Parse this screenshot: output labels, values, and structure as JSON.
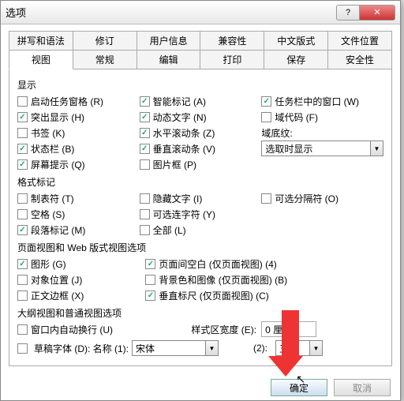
{
  "window": {
    "title": "选项"
  },
  "tabs_row1": [
    "拼写和语法",
    "修订",
    "用户信息",
    "兼容性",
    "中文版式",
    "文件位置"
  ],
  "tabs_row2": [
    "视图",
    "常规",
    "编辑",
    "打印",
    "保存",
    "安全性"
  ],
  "active_tab": "视图",
  "sections": {
    "display": {
      "title": "显示",
      "col1": [
        {
          "label": "启动任务窗格 (R)",
          "checked": false
        },
        {
          "label": "突出显示 (H)",
          "checked": true
        },
        {
          "label": "书签 (K)",
          "checked": false
        },
        {
          "label": "状态栏 (B)",
          "checked": true
        },
        {
          "label": "屏幕提示 (Q)",
          "checked": true
        }
      ],
      "col2": [
        {
          "label": "智能标记 (A)",
          "checked": true
        },
        {
          "label": "动态文字 (N)",
          "checked": true
        },
        {
          "label": "水平滚动条 (Z)",
          "checked": true
        },
        {
          "label": "垂直滚动条 (V)",
          "checked": true
        },
        {
          "label": "图片框 (P)",
          "checked": false
        }
      ],
      "col3": [
        {
          "label": "任务栏中的窗口 (W)",
          "checked": true
        },
        {
          "label": "域代码 (F)",
          "checked": false
        }
      ],
      "shading_label": "域底纹:",
      "shading_value": "选取时显示"
    },
    "marks": {
      "title": "格式标记",
      "col1": [
        {
          "label": "制表符 (T)",
          "checked": false
        },
        {
          "label": "空格 (S)",
          "checked": false
        },
        {
          "label": "段落标记 (M)",
          "checked": true
        }
      ],
      "col2": [
        {
          "label": "隐藏文字 (I)",
          "checked": false
        },
        {
          "label": "可选连字符 (Y)",
          "checked": false
        },
        {
          "label": "全部 (L)",
          "checked": false
        }
      ],
      "col3": [
        {
          "label": "可选分隔符 (O)",
          "checked": false
        }
      ]
    },
    "pageweb": {
      "title": "页面视图和 Web 版式视图选项",
      "col1": [
        {
          "label": "图形 (G)",
          "checked": true
        },
        {
          "label": "对象位置 (J)",
          "checked": false
        },
        {
          "label": "正文边框 (X)",
          "checked": false
        }
      ],
      "col2": [
        {
          "label": "页面间空白 (仅页面视图) (4)",
          "checked": true
        },
        {
          "label": "背景色和图像 (仅页面视图) (B)",
          "checked": false
        },
        {
          "label": "垂直标尺 (仅页面视图) (C)",
          "checked": true
        }
      ]
    },
    "outline": {
      "title": "大纲视图和普通视图选项",
      "wrap": {
        "label": "窗口内自动换行 (U)",
        "checked": false
      },
      "draft": {
        "label": "草稿字体 (D): 名称 (1):",
        "checked": false
      },
      "style_width_label": "样式区宽度 (E):",
      "style_width_value": "0 厘米",
      "font_name": "宋体",
      "size_label": "(2):",
      "size_value": "五号"
    }
  },
  "buttons": {
    "ok": "确定",
    "cancel": "取消"
  }
}
